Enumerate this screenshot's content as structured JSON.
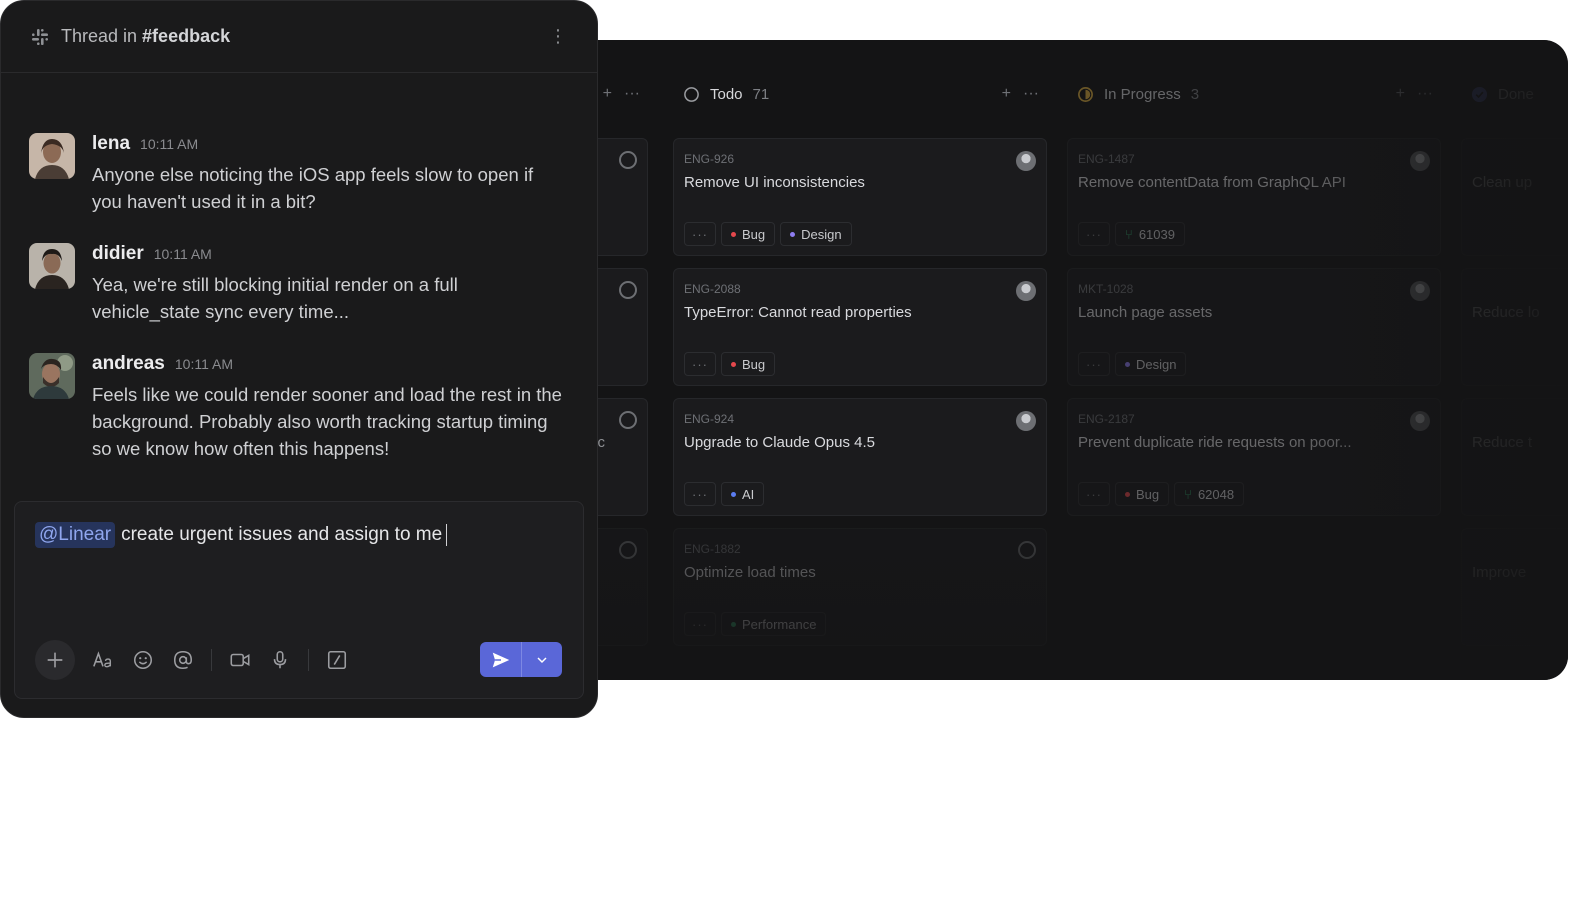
{
  "thread": {
    "prefix": "Thread in",
    "channel": "#feedback",
    "messages": [
      {
        "author": "lena",
        "time": "10:11 AM",
        "text": "Anyone else noticing the iOS app feels slow to open if you haven't used it in a bit?"
      },
      {
        "author": "didier",
        "time": "10:11 AM",
        "text": "Yea, we're still blocking initial render on a full vehicle_state sync every time..."
      },
      {
        "author": "andreas",
        "time": "10:11 AM",
        "text": "Feels like we could render sooner and load the rest in the background. Probably also worth tracking startup timing so we know how often this happens!"
      }
    ],
    "composer": {
      "mention": "@Linear",
      "text": "create urgent issues and assign to me"
    }
  },
  "board": {
    "columns": [
      {
        "name": "Todo",
        "count": "71",
        "cards": [
          {
            "id": "ENG-926",
            "title": "Remove UI inconsistencies",
            "tags": [
              {
                "label": "Bug",
                "color": "#e5484d"
              },
              {
                "label": "Design",
                "color": "#8e7cf0"
              }
            ]
          },
          {
            "id": "ENG-2088",
            "title": "TypeError: Cannot read properties",
            "tags": [
              {
                "label": "Bug",
                "color": "#e5484d"
              }
            ]
          },
          {
            "id": "ENG-924",
            "title": "Upgrade to Claude Opus 4.5",
            "tags": [
              {
                "label": "AI",
                "color": "#5b7cf0"
              }
            ]
          },
          {
            "id": "ENG-1882",
            "title": "Optimize load times",
            "tags": [
              {
                "label": "Performance",
                "color": "#30a46c"
              }
            ]
          }
        ]
      },
      {
        "name": "In Progress",
        "count": "3",
        "cards": [
          {
            "id": "ENG-1487",
            "title": "Remove contentData from GraphQL API",
            "pr": "61039"
          },
          {
            "id": "MKT-1028",
            "title": "Launch page assets",
            "tags": [
              {
                "label": "Design",
                "color": "#8e7cf0"
              }
            ]
          },
          {
            "id": "ENG-2187",
            "title": "Prevent duplicate ride requests on poor...",
            "tags": [
              {
                "label": "Bug",
                "color": "#e5484d"
              }
            ],
            "pr": "62048"
          }
        ]
      },
      {
        "name": "Done",
        "cards": [
          {
            "title": "Clean up"
          },
          {
            "title": "Reduce lo"
          },
          {
            "title": "Reduce t"
          },
          {
            "title": "Improve"
          }
        ]
      }
    ],
    "partial_left_texts": [
      "c"
    ]
  },
  "colors": {
    "send_button": "#5a67d8",
    "in_progress_status": "#e2b340",
    "done_status": "#5e6ad2"
  }
}
